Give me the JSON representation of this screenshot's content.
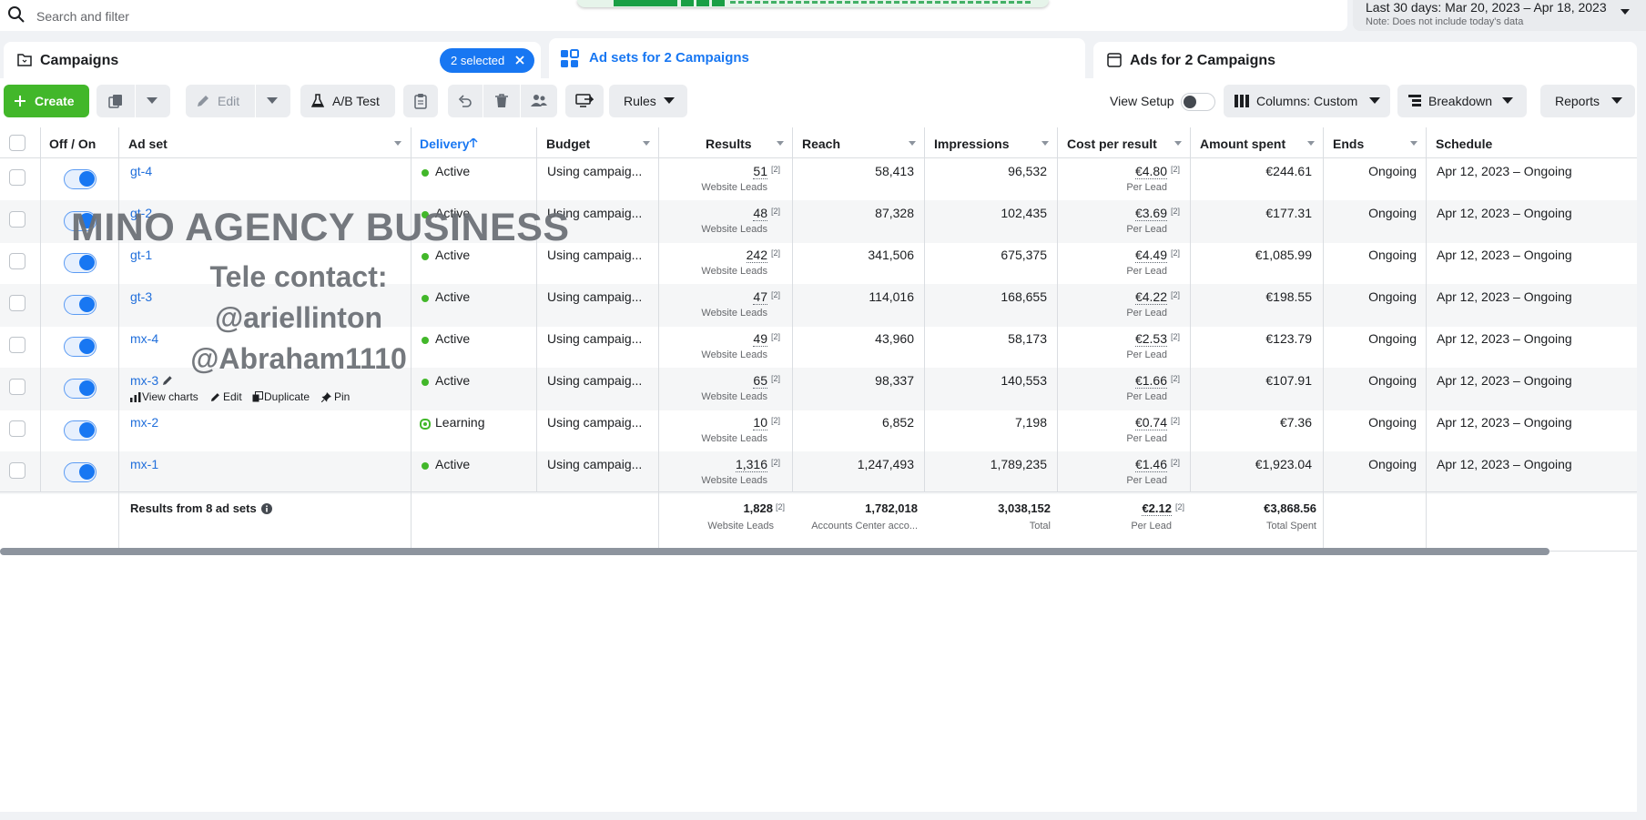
{
  "search": {
    "placeholder": "Search and filter"
  },
  "date_range": {
    "label": "Last 30 days: Mar 20, 2023 – Apr 18, 2023",
    "note": "Note: Does not include today's data"
  },
  "tabs": [
    {
      "label": "Campaigns",
      "chip": "2 selected"
    },
    {
      "label": "Ad sets for 2 Campaigns"
    },
    {
      "label": "Ads for 2 Campaigns"
    }
  ],
  "toolbar": {
    "create": "Create",
    "edit": "Edit",
    "ab_test": "A/B Test",
    "rules": "Rules",
    "view_setup": "View Setup",
    "columns": "Columns: Custom",
    "breakdown": "Breakdown",
    "reports": "Reports"
  },
  "columns": [
    "Off / On",
    "Ad set",
    "Delivery",
    "Budget",
    "Results",
    "Reach",
    "Impressions",
    "Cost per result",
    "Amount spent",
    "Ends",
    "Schedule"
  ],
  "rows": [
    {
      "name": "gt-4",
      "delivery": "Active",
      "budget": "Using campaig...",
      "results": "51",
      "results_sub": "Website Leads",
      "reach": "58,413",
      "impressions": "96,532",
      "cpr": "€4.80",
      "cpr_sub": "Per Lead",
      "spent": "€244.61",
      "ends": "Ongoing",
      "schedule": "Apr 12, 2023 – Ongoing"
    },
    {
      "name": "gt-2",
      "delivery": "Active",
      "budget": "Using campaig...",
      "results": "48",
      "results_sub": "Website Leads",
      "reach": "87,328",
      "impressions": "102,435",
      "cpr": "€3.69",
      "cpr_sub": "Per Lead",
      "spent": "€177.31",
      "ends": "Ongoing",
      "schedule": "Apr 12, 2023 – Ongoing"
    },
    {
      "name": "gt-1",
      "delivery": "Active",
      "budget": "Using campaig...",
      "results": "242",
      "results_sub": "Website Leads",
      "reach": "341,506",
      "impressions": "675,375",
      "cpr": "€4.49",
      "cpr_sub": "Per Lead",
      "spent": "€1,085.99",
      "ends": "Ongoing",
      "schedule": "Apr 12, 2023 – Ongoing"
    },
    {
      "name": "gt-3",
      "delivery": "Active",
      "budget": "Using campaig...",
      "results": "47",
      "results_sub": "Website Leads",
      "reach": "114,016",
      "impressions": "168,655",
      "cpr": "€4.22",
      "cpr_sub": "Per Lead",
      "spent": "€198.55",
      "ends": "Ongoing",
      "schedule": "Apr 12, 2023 – Ongoing"
    },
    {
      "name": "mx-4",
      "delivery": "Active",
      "budget": "Using campaig...",
      "results": "49",
      "results_sub": "Website Leads",
      "reach": "43,960",
      "impressions": "58,173",
      "cpr": "€2.53",
      "cpr_sub": "Per Lead",
      "spent": "€123.79",
      "ends": "Ongoing",
      "schedule": "Apr 12, 2023 – Ongoing"
    },
    {
      "name": "mx-3",
      "delivery": "Active",
      "budget": "Using campaig...",
      "results": "65",
      "results_sub": "Website Leads",
      "reach": "98,337",
      "impressions": "140,553",
      "cpr": "€1.66",
      "cpr_sub": "Per Lead",
      "spent": "€107.91",
      "ends": "Ongoing",
      "schedule": "Apr 12, 2023 – Ongoing"
    },
    {
      "name": "mx-2",
      "delivery": "Learning",
      "budget": "Using campaig...",
      "results": "10",
      "results_sub": "Website Leads",
      "reach": "6,852",
      "impressions": "7,198",
      "cpr": "€0.74",
      "cpr_sub": "Per Lead",
      "spent": "€7.36",
      "ends": "Ongoing",
      "schedule": "Apr 12, 2023 – Ongoing"
    },
    {
      "name": "mx-1",
      "delivery": "Active",
      "budget": "Using campaig...",
      "results": "1,316",
      "results_sub": "Website Leads",
      "reach": "1,247,493",
      "impressions": "1,789,235",
      "cpr": "€1.46",
      "cpr_sub": "Per Lead",
      "spent": "€1,923.04",
      "ends": "Ongoing",
      "schedule": "Apr 12, 2023 – Ongoing"
    }
  ],
  "ref_mark": "[2]",
  "row_actions": {
    "view_charts": "View charts",
    "edit": "Edit",
    "duplicate": "Duplicate",
    "pin": "Pin"
  },
  "totals": {
    "label": "Results from 8 ad sets",
    "results": "1,828",
    "results_sub": "Website Leads",
    "reach": "1,782,018",
    "reach_sub": "Accounts Center acco...",
    "impressions": "3,038,152",
    "impressions_sub": "Total",
    "cpr": "€2.12",
    "cpr_sub": "Per Lead",
    "spent": "€3,868.56",
    "spent_sub": "Total Spent"
  },
  "watermark": {
    "line1": "MINO AGENCY BUSINESS",
    "line2": "Tele contact:",
    "line3": "@ariellinton",
    "line4": "@Abraham1110"
  },
  "colors": {
    "accent": "#1877f2",
    "create": "#42b72a",
    "link": "#216fdb",
    "status_active": "#42b72a"
  }
}
